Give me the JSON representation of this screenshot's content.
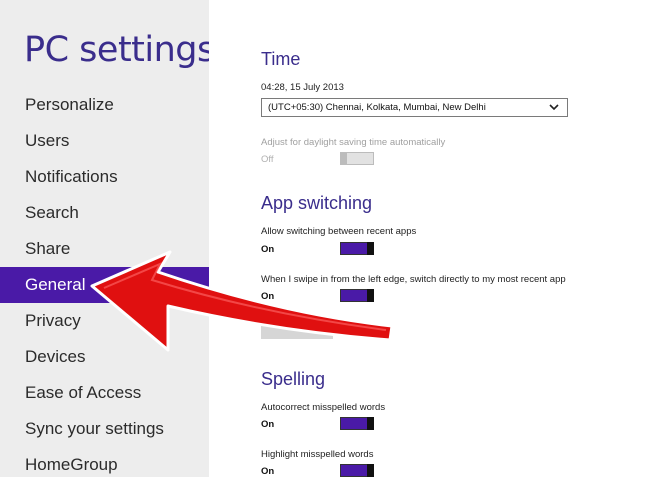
{
  "sidebar": {
    "title": "PC settings",
    "items": [
      {
        "label": "Personalize"
      },
      {
        "label": "Users"
      },
      {
        "label": "Notifications"
      },
      {
        "label": "Search"
      },
      {
        "label": "Share"
      },
      {
        "label": "General",
        "selected": true
      },
      {
        "label": "Privacy"
      },
      {
        "label": "Devices"
      },
      {
        "label": "Ease of Access"
      },
      {
        "label": "Sync your settings"
      },
      {
        "label": "HomeGroup"
      }
    ]
  },
  "main": {
    "time": {
      "title": "Time",
      "datetime": "04:28, 15 July 2013",
      "timezone": "(UTC+05:30) Chennai, Kolkata, Mumbai, New Delhi",
      "dst_label": "Adjust for daylight saving time automatically",
      "dst_state": "Off",
      "dst_on": false
    },
    "app_switching": {
      "title": "App switching",
      "allow_label": "Allow switching between recent apps",
      "allow_state": "On",
      "allow_on": true,
      "swipe_label": "When I swipe in from the left edge, switch directly to my most recent app",
      "swipe_state": "On",
      "swipe_on": true
    },
    "spelling": {
      "title": "Spelling",
      "autocorrect_label": "Autocorrect misspelled words",
      "autocorrect_state": "On",
      "autocorrect_on": true,
      "highlight_label": "Highlight misspelled words",
      "highlight_state": "On",
      "highlight_on": true
    }
  },
  "colors": {
    "accent": "#4a1aa7",
    "title": "#3a2d8c",
    "sidebar_bg": "#ededed",
    "arrow_red": "#e01010"
  },
  "annotation": {
    "icon": "red-arrow-icon"
  }
}
